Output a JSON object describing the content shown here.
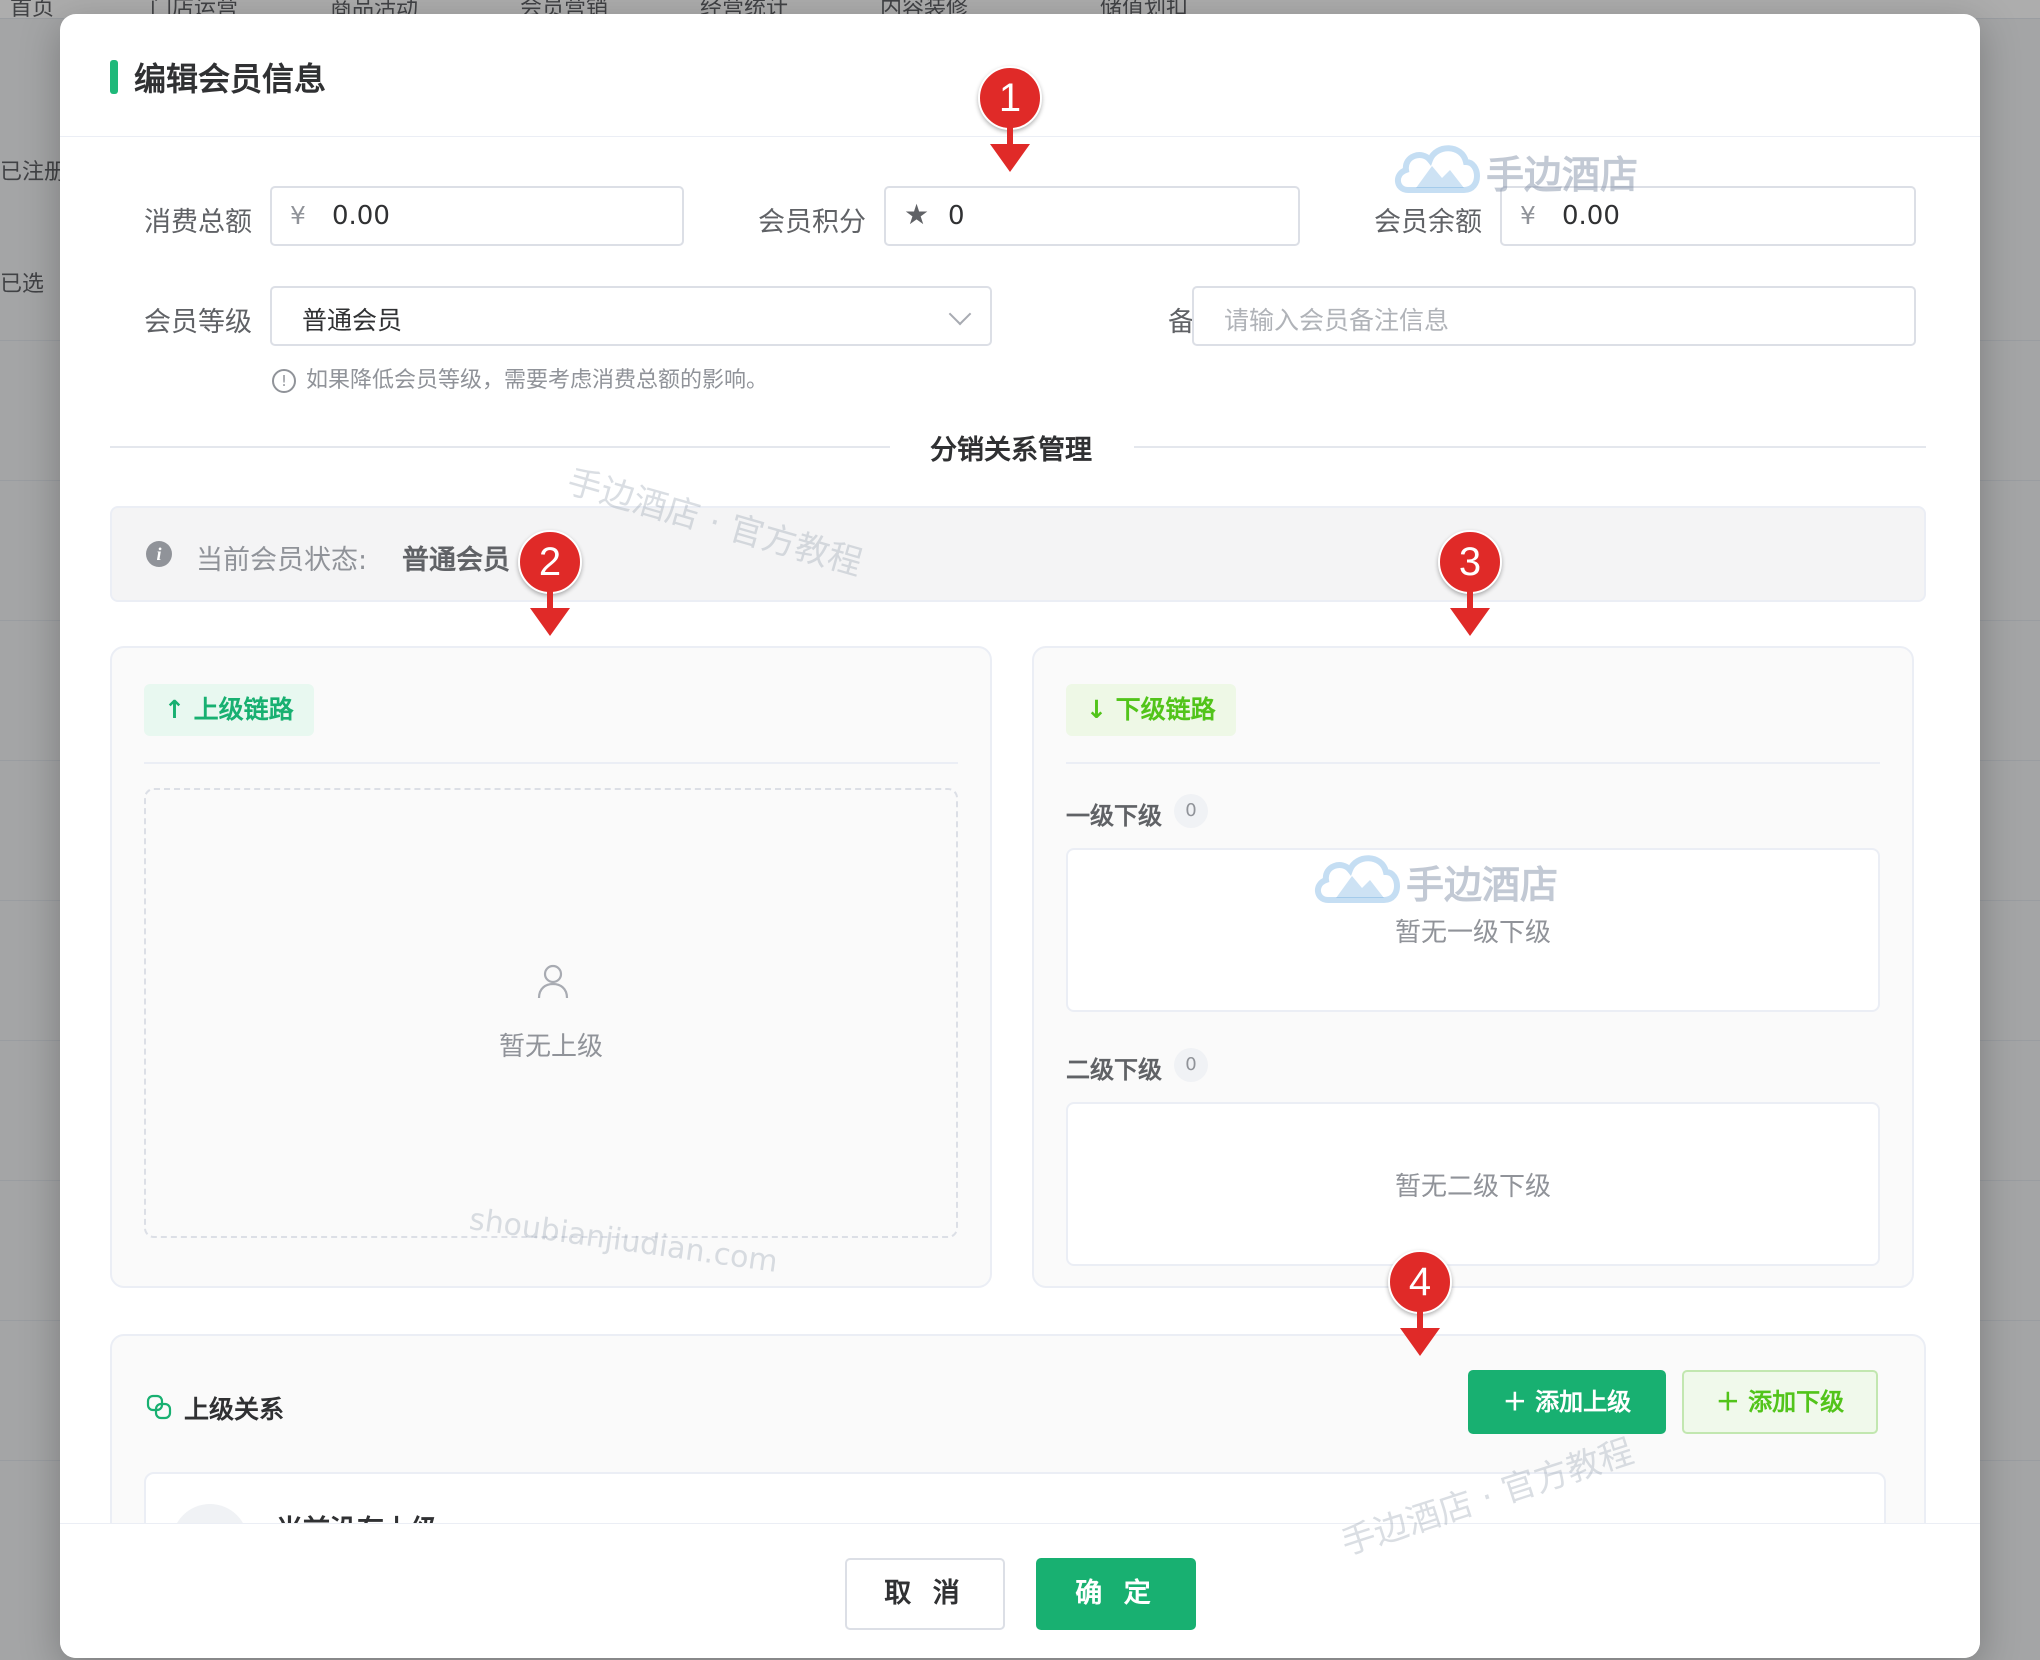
{
  "background": {
    "nav_items": [
      "首页",
      "门店运营",
      "商品活动",
      "会员营销",
      "经营统计",
      "内容装修",
      "储值划扣"
    ],
    "side_texts": [
      "已注册",
      "已选"
    ]
  },
  "dialog": {
    "title": "编辑会员信息",
    "fields": {
      "total_spend_label": "消费总额",
      "total_spend_prefix": "¥",
      "total_spend_value": "0.00",
      "points_label": "会员积分",
      "points_icon": "star-icon",
      "points_value": "0",
      "balance_label": "会员余额",
      "balance_prefix": "¥",
      "balance_value": "0.00",
      "level_label": "会员等级",
      "level_value": "普通会员",
      "remark_label": "备注",
      "remark_placeholder": "请输入会员备注信息",
      "level_tip": "如果降低会员等级，需要考虑消费总额的影响。"
    },
    "distribution": {
      "section_title": "分销关系管理",
      "status_label": "当前会员状态:",
      "status_value": "普通会员",
      "upline": {
        "tag": "上级链路",
        "empty": "暂无上级"
      },
      "downline": {
        "tag": "下级链路",
        "level1_label": "一级下级",
        "level1_count": "0",
        "level1_empty": "暂无一级下级",
        "level2_label": "二级下级",
        "level2_count": "0",
        "level2_empty": "暂无二级下级"
      }
    },
    "relations": {
      "title": "上级关系",
      "add_upline_button": "添加上级",
      "add_downline_button": "添加下级",
      "current_title": "当前没有上级"
    },
    "footer": {
      "cancel": "取 消",
      "confirm": "确 定"
    }
  },
  "watermarks": {
    "brand": "手边酒店",
    "tutorial": "手边酒店 · 官方教程",
    "domain": "shoubianjiudian.com"
  },
  "markers": [
    "1",
    "2",
    "3",
    "4"
  ],
  "colors": {
    "primary_green": "#18b071",
    "lime_green": "#52c41a",
    "marker_red": "#e02a28"
  }
}
